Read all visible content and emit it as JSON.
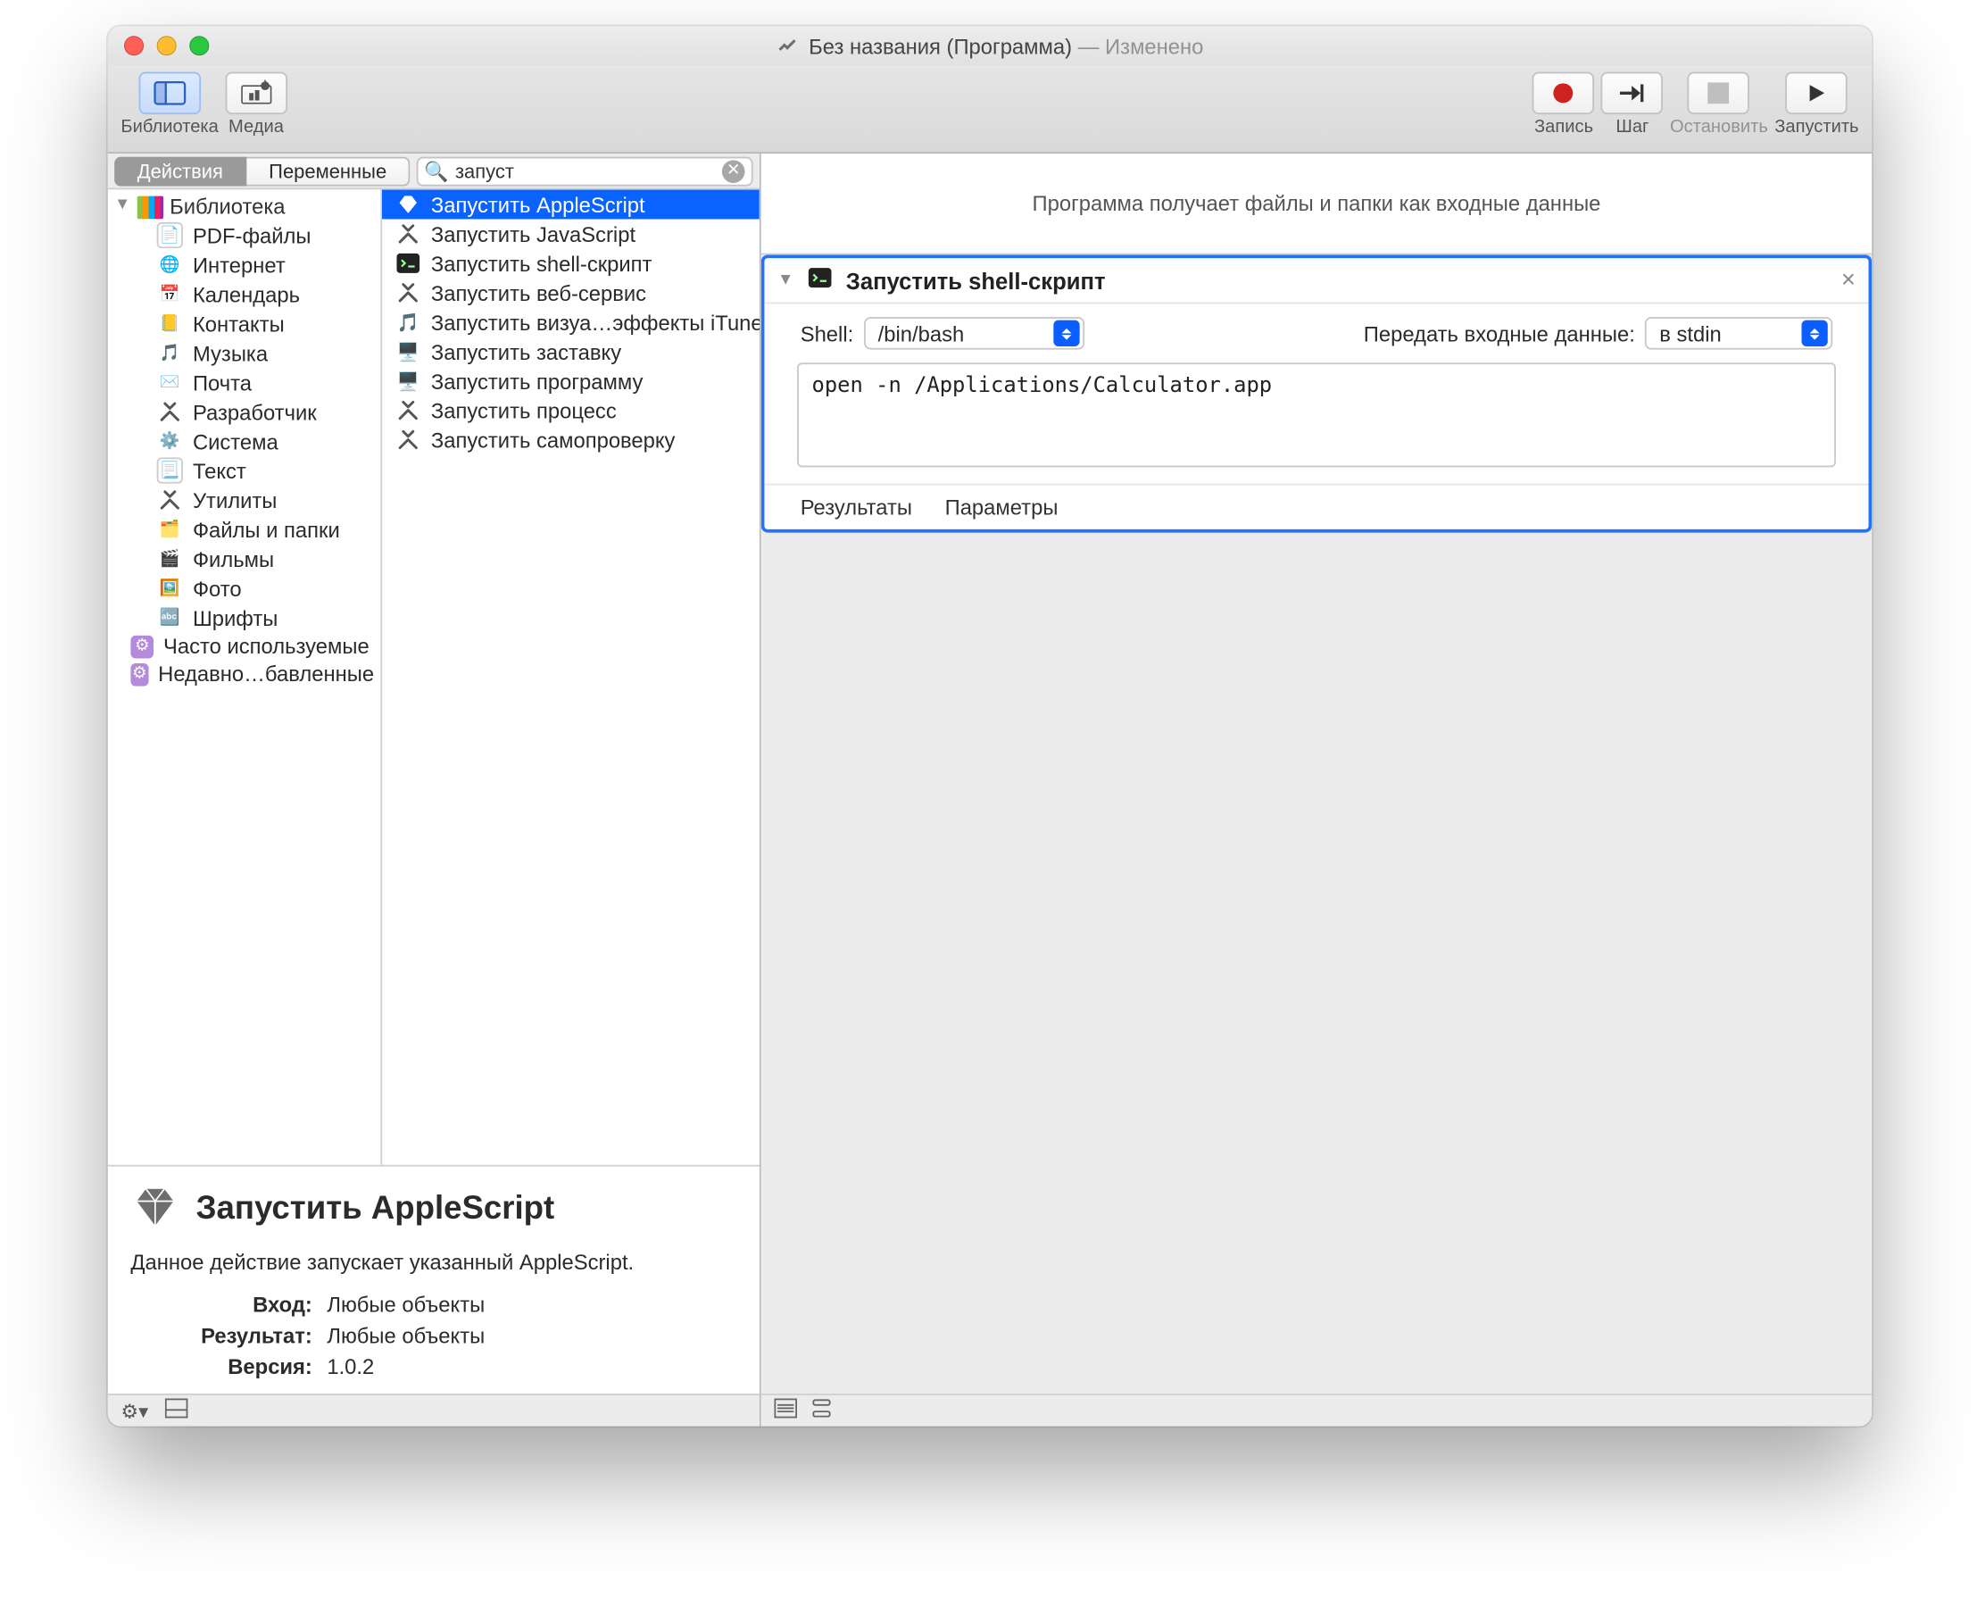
{
  "window": {
    "title": "Без названия (Программа)",
    "status": "— Изменено"
  },
  "toolbar": {
    "library": "Библиотека",
    "media": "Медиа",
    "record": "Запись",
    "step": "Шаг",
    "stop": "Остановить",
    "run": "Запустить"
  },
  "subtoolbar": {
    "tab_actions": "Действия",
    "tab_variables": "Переменные",
    "search_value": "запуст"
  },
  "categories": {
    "root": "Библиотека",
    "items": [
      {
        "label": "PDF-файлы"
      },
      {
        "label": "Интернет"
      },
      {
        "label": "Календарь"
      },
      {
        "label": "Контакты"
      },
      {
        "label": "Музыка"
      },
      {
        "label": "Почта"
      },
      {
        "label": "Разработчик"
      },
      {
        "label": "Система"
      },
      {
        "label": "Текст"
      },
      {
        "label": "Утилиты"
      },
      {
        "label": "Файлы и папки"
      },
      {
        "label": "Фильмы"
      },
      {
        "label": "Фото"
      },
      {
        "label": "Шрифты"
      }
    ],
    "smart": [
      {
        "label": "Часто используемые"
      },
      {
        "label": "Недавно…бавленные"
      }
    ]
  },
  "actions": {
    "items": [
      {
        "label": "Запустить AppleScript",
        "selected": true,
        "kind": "hammers"
      },
      {
        "label": "Запустить JavaScript",
        "kind": "hammers"
      },
      {
        "label": "Запустить shell-скрипт",
        "kind": "terminal"
      },
      {
        "label": "Запустить веб-сервис",
        "kind": "hammers"
      },
      {
        "label": "Запустить визуа…эффекты iTunes",
        "kind": "itunes"
      },
      {
        "label": "Запустить заставку",
        "kind": "screensaver"
      },
      {
        "label": "Запустить программу",
        "kind": "finder"
      },
      {
        "label": "Запустить процесс",
        "kind": "hammers"
      },
      {
        "label": "Запустить самопроверку",
        "kind": "hammers"
      }
    ]
  },
  "info": {
    "title": "Запустить AppleScript",
    "desc": "Данное действие запускает указанный AppleScript.",
    "rows": {
      "input_k": "Вход:",
      "input_v": "Любые объекты",
      "result_k": "Результат:",
      "result_v": "Любые объекты",
      "version_k": "Версия:",
      "version_v": "1.0.2"
    }
  },
  "canvas": {
    "header": "Программа получает файлы и папки как входные данные",
    "card": {
      "title": "Запустить shell-скрипт",
      "shell_label": "Shell:",
      "shell_value": "/bin/bash",
      "pass_label": "Передать входные данные:",
      "pass_value": "в stdin",
      "editor": "open -n /Applications/Calculator.app",
      "tab_results": "Результаты",
      "tab_params": "Параметры"
    }
  }
}
